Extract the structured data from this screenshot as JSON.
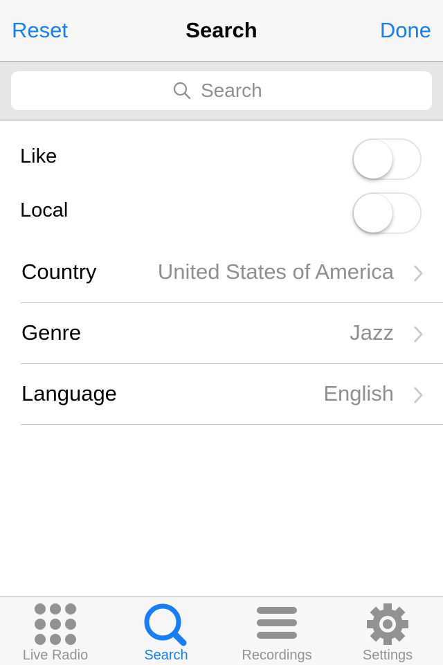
{
  "navbar": {
    "left_button": "Reset",
    "title": "Search",
    "right_button": "Done"
  },
  "search": {
    "placeholder": "Search",
    "value": "",
    "icon": "magnifier-icon"
  },
  "toggles": [
    {
      "label": "Like",
      "on": false
    },
    {
      "label": "Local",
      "on": false
    }
  ],
  "rows": [
    {
      "label": "Country",
      "value": "United States of America",
      "icon": "chevron-right-icon"
    },
    {
      "label": "Genre",
      "value": "Jazz",
      "icon": "chevron-right-icon"
    },
    {
      "label": "Language",
      "value": "English",
      "icon": "chevron-right-icon"
    }
  ],
  "tabbar": {
    "active": "Search",
    "tabs": [
      {
        "label": "Live Radio",
        "icon": "dot-grid-icon"
      },
      {
        "label": "Search",
        "icon": "magnifier-icon"
      },
      {
        "label": "Recordings",
        "icon": "list-lines-icon"
      },
      {
        "label": "Settings",
        "icon": "gear-icon"
      }
    ]
  },
  "colors": {
    "accent": "#157efb",
    "inactive": "#929292",
    "secondary_text": "#8e8e93"
  }
}
